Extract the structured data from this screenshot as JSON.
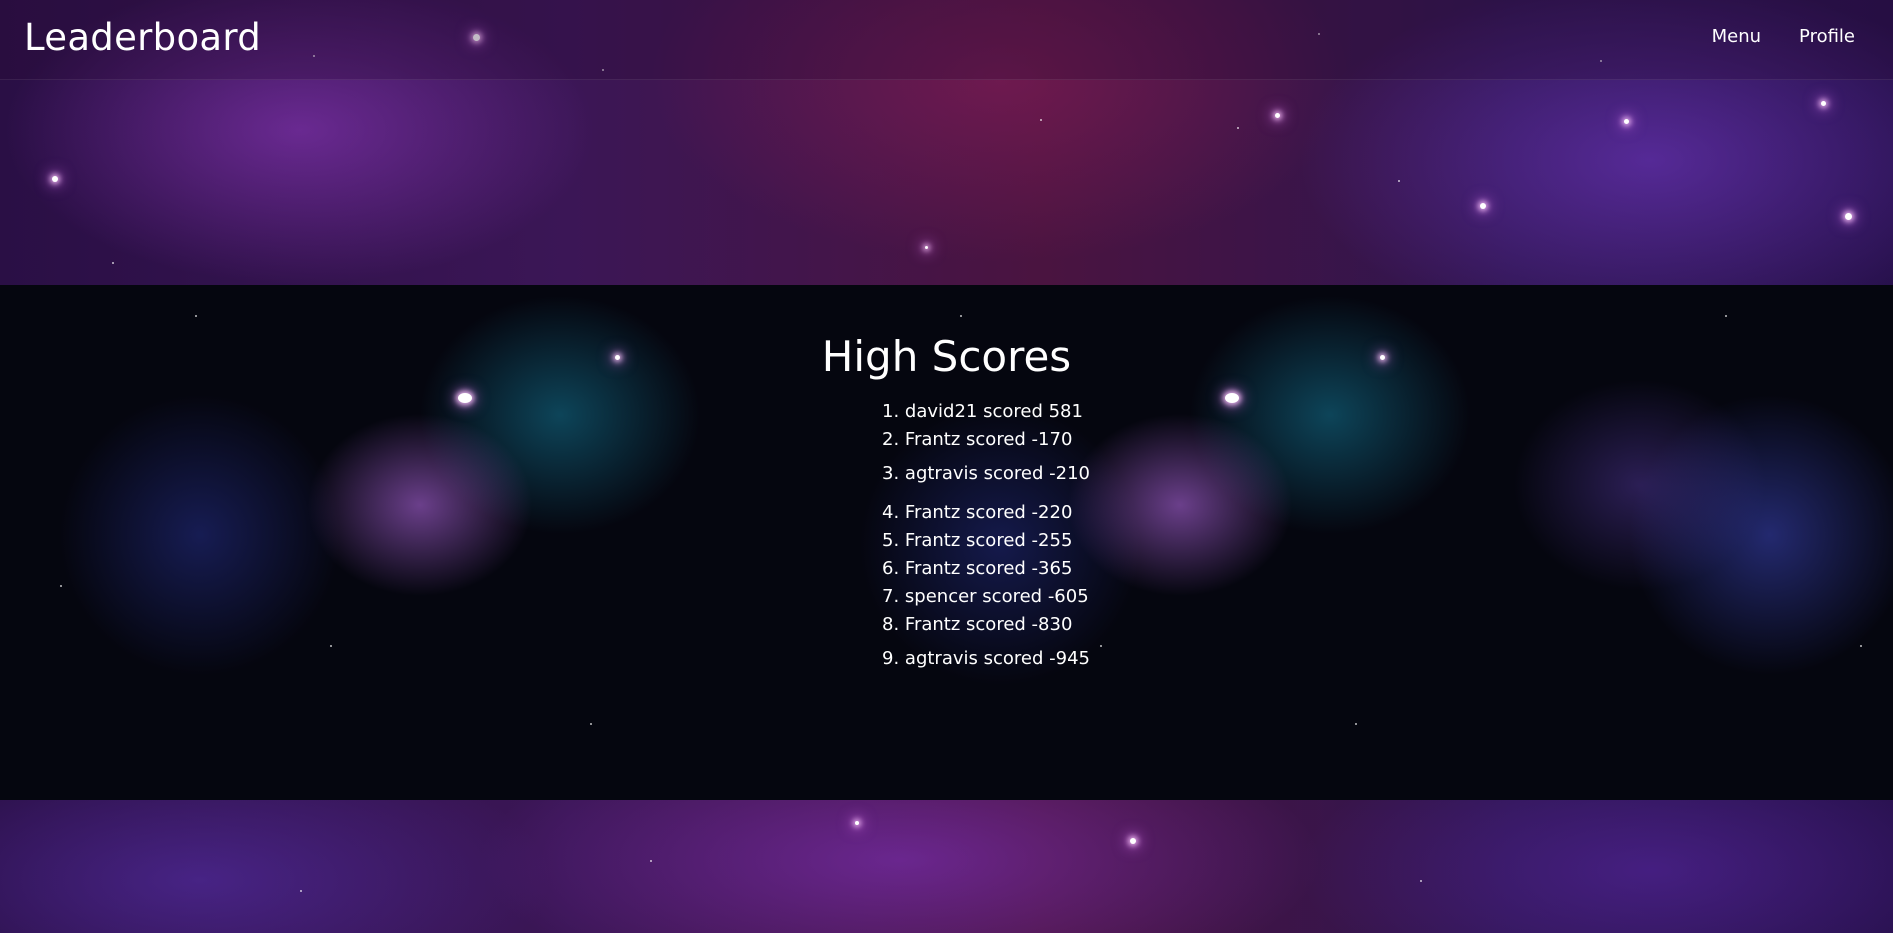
{
  "navbar": {
    "brand": "Leaderboard",
    "links": [
      {
        "label": "Menu"
      },
      {
        "label": "Profile"
      }
    ]
  },
  "leaderboard": {
    "title": "High Scores",
    "scores": [
      {
        "rank": "1.",
        "text": "david21 scored 581"
      },
      {
        "rank": "2.",
        "text": "Frantz scored -170"
      },
      {
        "rank": "3.",
        "text": "agtravis scored -210"
      },
      {
        "rank": "4.",
        "text": "Frantz scored -220"
      },
      {
        "rank": "5.",
        "text": "Frantz scored -255"
      },
      {
        "rank": "6.",
        "text": "Frantz scored -365"
      },
      {
        "rank": "7.",
        "text": "spencer scored -605"
      },
      {
        "rank": "8.",
        "text": "Frantz scored -830"
      },
      {
        "rank": "9.",
        "text": "agtravis scored -945"
      }
    ]
  },
  "colors": {
    "text": "#ffffff",
    "header_bg": "#3b1656",
    "panel_bg": "#05060f"
  }
}
